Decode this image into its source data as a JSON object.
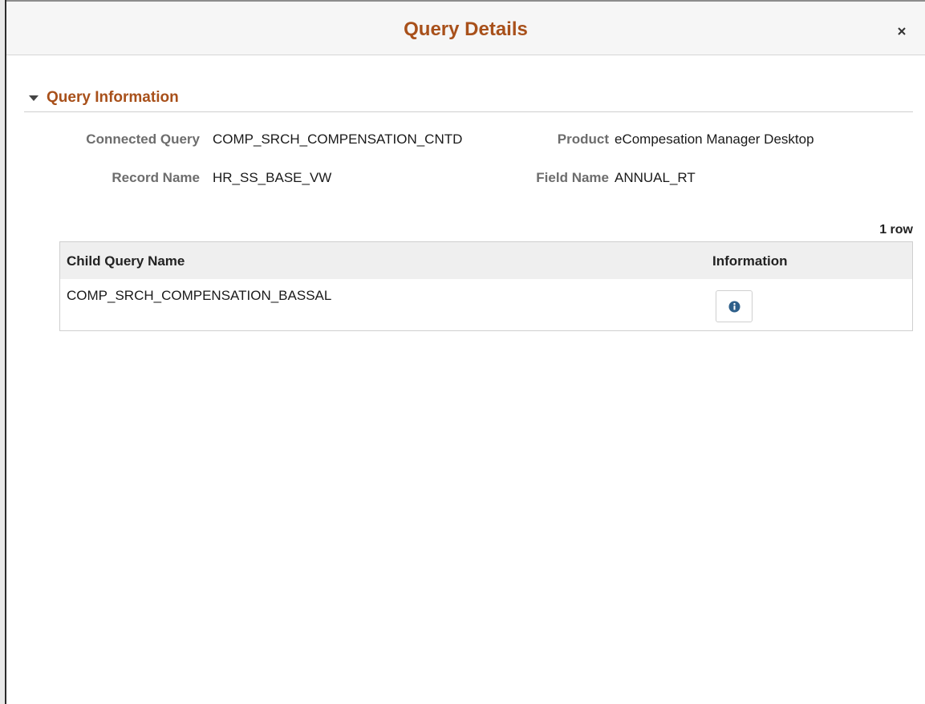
{
  "modal": {
    "title": "Query Details",
    "close_icon": "close-icon"
  },
  "section": {
    "title": "Query Information",
    "collapse_icon": "caret-down-icon"
  },
  "fields": {
    "connected_query": {
      "label": "Connected Query",
      "value": "COMP_SRCH_COMPENSATION_CNTD"
    },
    "product": {
      "label": "Product",
      "value": "eCompesation Manager Desktop"
    },
    "record_name": {
      "label": "Record Name",
      "value": "HR_SS_BASE_VW"
    },
    "field_name": {
      "label": "Field Name",
      "value": "ANNUAL_RT"
    }
  },
  "grid": {
    "row_count": "1 row",
    "columns": [
      "Child Query Name",
      "Information"
    ],
    "rows": [
      {
        "child_query_name": "COMP_SRCH_COMPENSATION_BASSAL",
        "info_icon": "info-icon"
      }
    ]
  },
  "colors": {
    "title": "#a8501a",
    "info_icon": "#2e5f8a",
    "header_bg": "#f6f6f6"
  }
}
